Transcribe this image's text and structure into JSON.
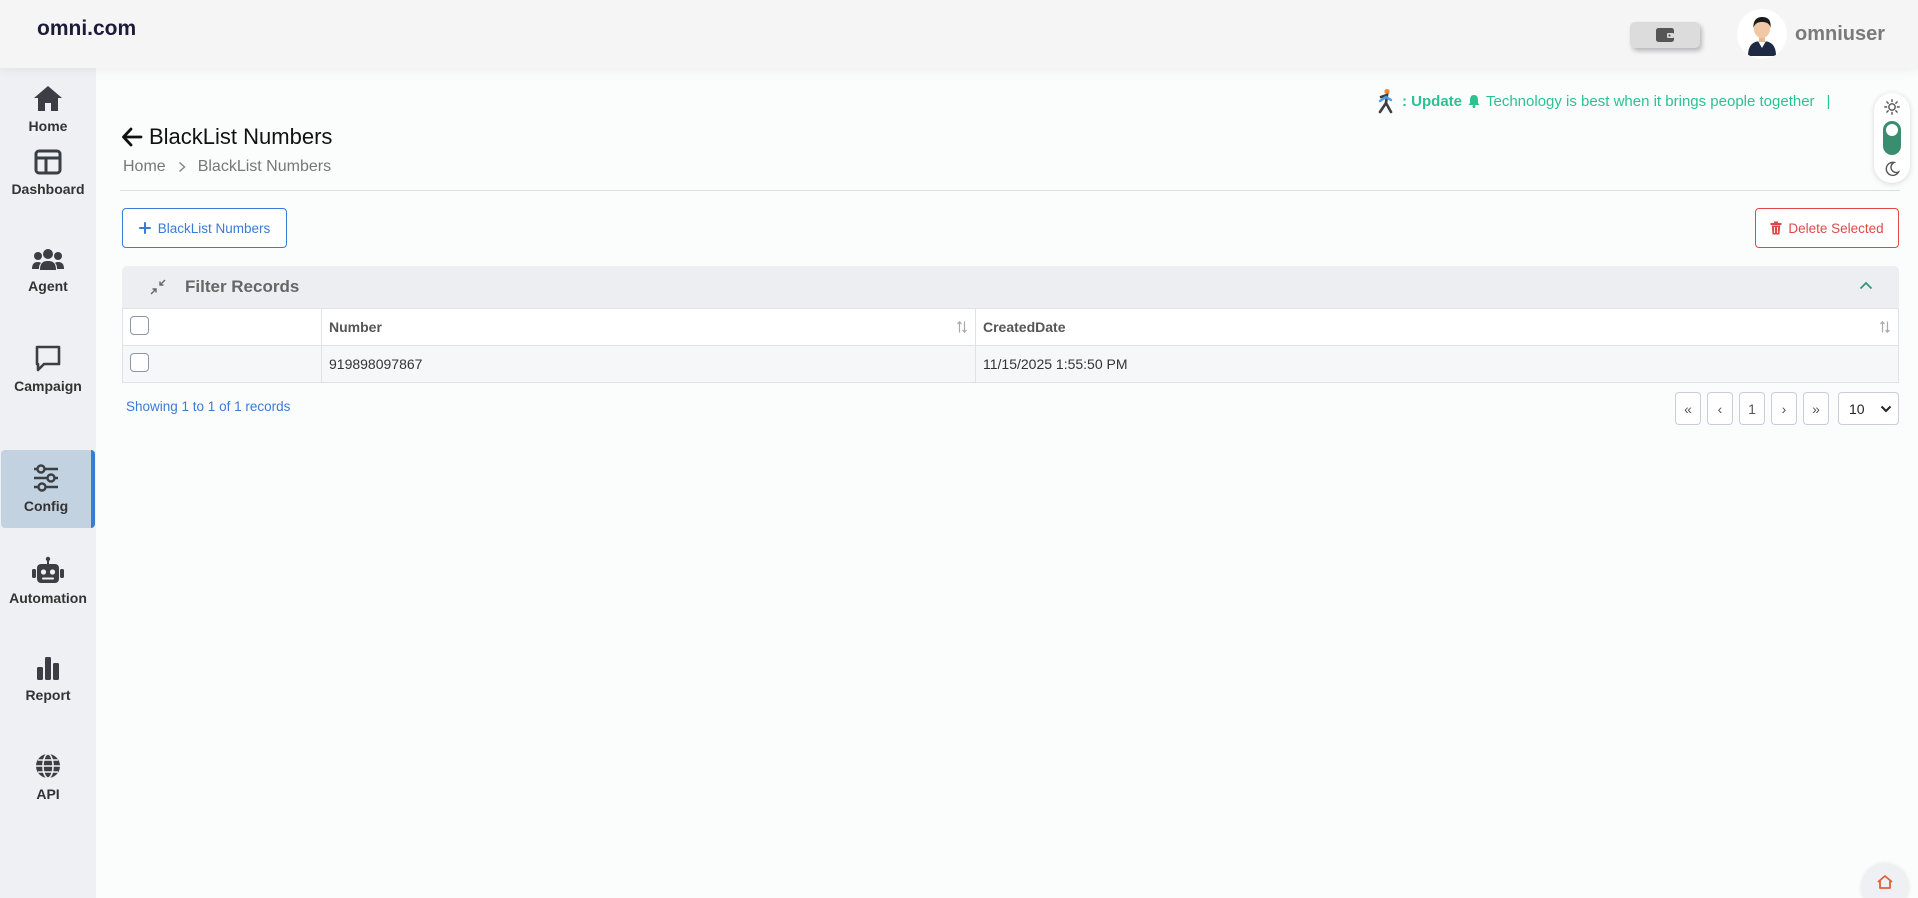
{
  "header": {
    "brand": "omni.com",
    "username": "omniuser"
  },
  "sidebar": {
    "items": [
      {
        "label": "Home",
        "icon": "home-icon"
      },
      {
        "label": "Dashboard",
        "icon": "dashboard-icon"
      },
      {
        "label": "Agent",
        "icon": "users-icon"
      },
      {
        "label": "Campaign",
        "icon": "chat-icon"
      },
      {
        "label": "Config",
        "icon": "sliders-icon",
        "active": true
      },
      {
        "label": "Automation",
        "icon": "robot-icon"
      },
      {
        "label": "Report",
        "icon": "bar-chart-icon"
      },
      {
        "label": "API",
        "icon": "globe-icon"
      }
    ]
  },
  "ticker": {
    "prefix": ": Update",
    "message": "Technology is best when it brings people together",
    "cursor": "|"
  },
  "page": {
    "title": "BlackList Numbers",
    "breadcrumb": {
      "home": "Home",
      "current": "BlackList Numbers"
    }
  },
  "toolbar": {
    "add_label": "BlackList Numbers",
    "delete_label": "Delete Selected"
  },
  "filter": {
    "title": "Filter Records"
  },
  "table": {
    "columns": [
      "Number",
      "CreatedDate"
    ],
    "rows": [
      {
        "number": "919898097867",
        "created": "11/15/2025 1:55:50 PM"
      }
    ]
  },
  "pagination": {
    "summary": "Showing 1 to 1 of 1 records",
    "first": "«",
    "prev": "‹",
    "current": "1",
    "next": "›",
    "last": "»",
    "page_size": "10"
  },
  "colors": {
    "accent": "#3a7bd5",
    "danger": "#e04848",
    "ticker": "#2bc291",
    "toggle": "#3a8d6f"
  }
}
